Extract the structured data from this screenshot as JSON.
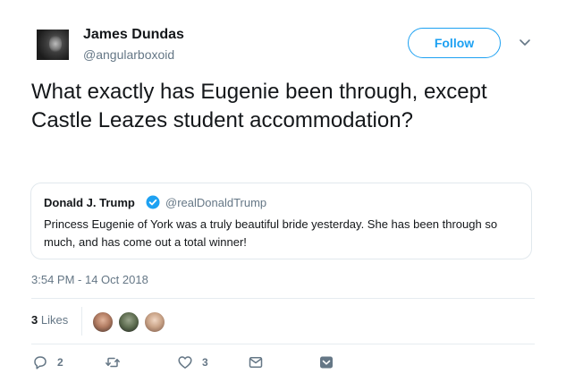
{
  "author": {
    "name": "James Dundas",
    "handle": "@angularboxoid",
    "avatar_icon": "avatar-image"
  },
  "follow": {
    "label": "Follow",
    "color": "#1da1f2"
  },
  "tweet": {
    "text": "What exactly has Eugenie been through, except Castle Leazes student accommodation?"
  },
  "quoted": {
    "name": "Donald J. Trump",
    "handle": "@realDonaldTrump",
    "verified_icon": "verified-badge-icon",
    "text": "Princess Eugenie of York was a truly beautiful bride yesterday. She has been through so much, and has come out a total winner!"
  },
  "timestamp": "3:54 PM - 14 Oct 2018",
  "stats": {
    "likes_count": "3",
    "likes_label": "Likes"
  },
  "actions": {
    "reply_count": "2",
    "retweet_count": "",
    "like_count": "3"
  },
  "colors": {
    "accent": "#1da1f2",
    "muted": "#657786",
    "text": "#14171a"
  }
}
